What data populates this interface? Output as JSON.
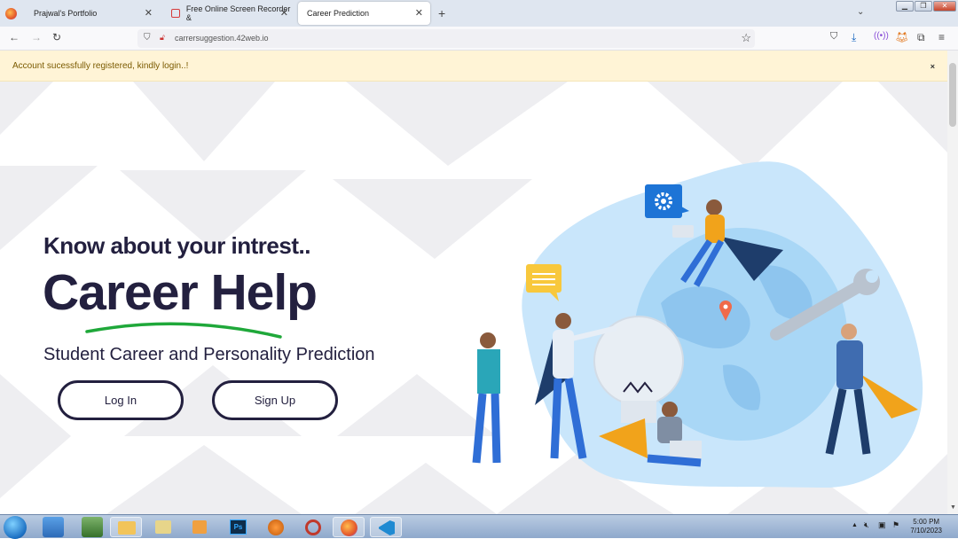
{
  "browser": {
    "tabs": [
      {
        "title": "Prajwal's Portfolio"
      },
      {
        "title": "Free Online Screen Recorder &"
      },
      {
        "title": "Career Prediction"
      }
    ],
    "url": "carrersuggestion.42web.io"
  },
  "notice": {
    "text": "Account sucessfully registered, kindly login..!",
    "close": "×"
  },
  "hero": {
    "tagline": "Know about your intrest..",
    "title": "Career Help",
    "subtitle": "Student Career and Personality Prediction",
    "login_label": "Log In",
    "signup_label": "Sign Up"
  },
  "taskbar": {
    "time": "5:00 PM",
    "date": "7/10/2023"
  },
  "colors": {
    "navy": "#23203f",
    "accent_green": "#1fa83a",
    "notice_bg": "#fff4d6",
    "blob": "#c9e6fb"
  }
}
